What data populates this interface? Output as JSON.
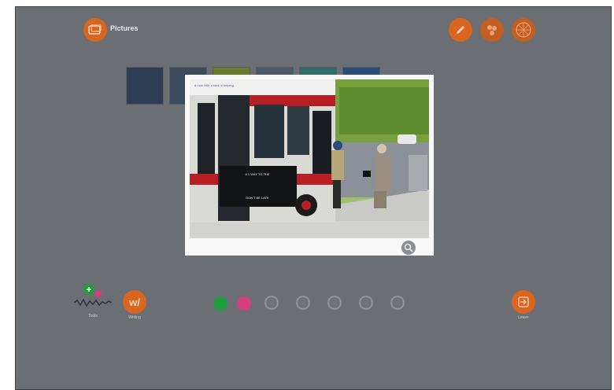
{
  "header": {
    "title": "Pictures",
    "icons": [
      "pictures-icon",
      "pencil-icon",
      "people-group-icon",
      "texture-globe-icon"
    ]
  },
  "thumbnails": {
    "colors": [
      "#2e3f55",
      "#3b4a5c",
      "#6c7a2e",
      "#4d5a66",
      "#2f6d6a",
      "#2b4e78"
    ]
  },
  "photo": {
    "top_text": "a man with a stick is helping",
    "bus_sign_1": "# 1 WAY TO THE",
    "bus_sign_2": "DON'T BE LATE",
    "zoom_icon": "zoom-icon"
  },
  "toolbar": {
    "left_label_1": "Tools",
    "left_label_2": "Writing",
    "right_label": "Leave",
    "color_green": "#1f9d3c",
    "color_pink": "#d43f7f",
    "accent": "#d9651f"
  }
}
